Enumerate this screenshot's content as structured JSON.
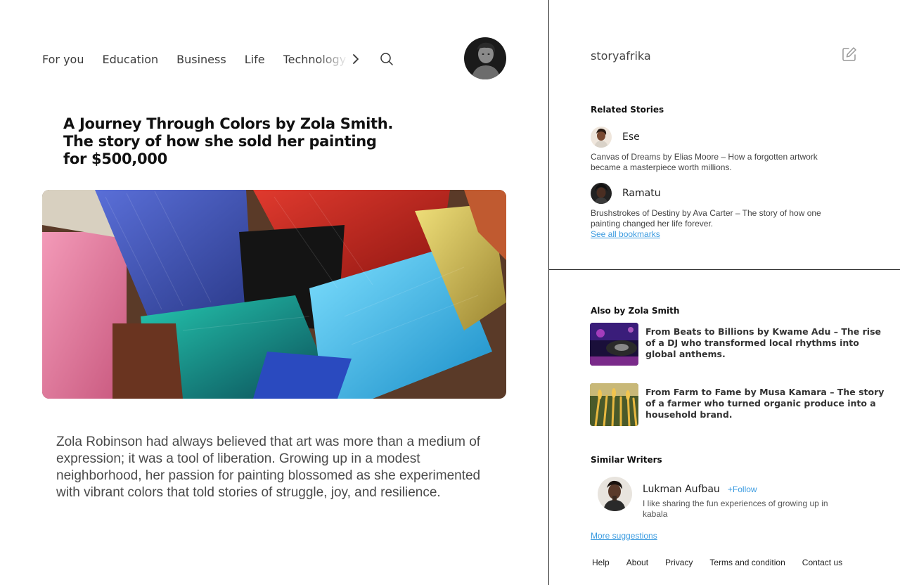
{
  "nav": {
    "items": [
      "For you",
      "Education",
      "Business",
      "Life",
      "Technology"
    ],
    "icons": [
      "chevron-right-icon",
      "search-icon"
    ]
  },
  "article": {
    "title": "A Journey Through Colors by Zola Smith. The story of how she sold her painting for $500,000",
    "body": "Zola Robinson had always believed that art was more than a medium of expression; it was a tool of liberation. Growing up in a modest neighborhood, her passion for painting blossomed as she experimented with vibrant colors that told stories of struggle, joy, and resilience."
  },
  "sidebar": {
    "brand": "storyafrika",
    "related": {
      "heading": "Related Stories",
      "items": [
        {
          "author": "Ese",
          "summary": "Canvas of Dreams by Elias Moore – How a forgotten artwork became a masterpiece worth millions."
        },
        {
          "author": "Ramatu",
          "summary": "Brushstrokes of Destiny by Ava Carter – The story of how one painting changed her life forever."
        }
      ],
      "link": "See all bookmarks"
    },
    "also": {
      "heading": "Also by Zola Smith",
      "items": [
        {
          "title": "From Beats to Billions by Kwame Adu – The rise of a DJ who transformed local rhythms into global anthems."
        },
        {
          "title": "From Farm to Fame by Musa Kamara – The story of a farmer who turned organic produce into a household brand."
        }
      ]
    },
    "writers": {
      "heading": "Similar Writers",
      "items": [
        {
          "name": "Lukman Aufbau",
          "follow": "+Follow",
          "bio": "I like sharing the fun experiences of growing up in kabala"
        }
      ],
      "link": "More suggestions"
    },
    "footer": [
      "Help",
      "About",
      "Privacy",
      "Terms and condition",
      "Contact us"
    ]
  },
  "colors": {
    "accent": "#3b9be0",
    "divider": "#222222"
  }
}
